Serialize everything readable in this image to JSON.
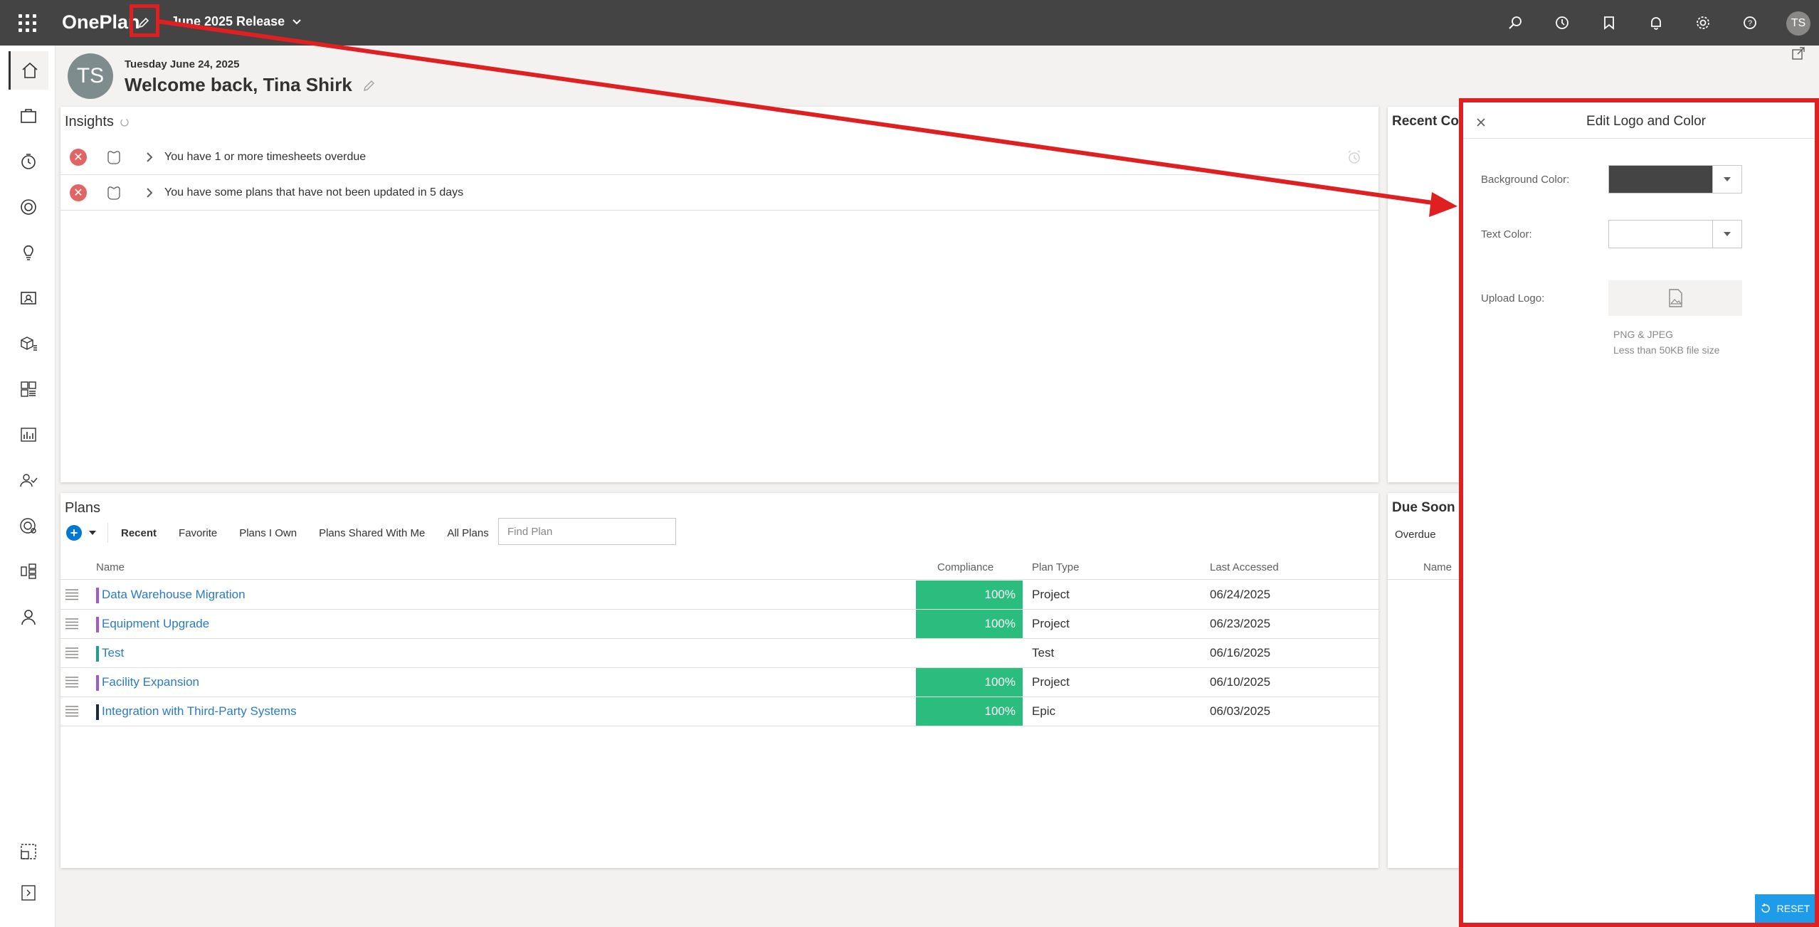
{
  "topbar": {
    "app_name": "OnePlan",
    "release_label": "June 2025 Release",
    "avatar_initials": "TS",
    "bg_color": "#444444"
  },
  "header": {
    "date": "Tuesday June 24, 2025",
    "welcome": "Welcome back, Tina Shirk",
    "avatar_initials": "TS"
  },
  "insights": {
    "title": "Insights",
    "items": [
      {
        "text": "You have 1 or more timesheets overdue"
      },
      {
        "text": "You have some plans that have not been updated in 5 days"
      }
    ]
  },
  "recent_comments": {
    "title": "Recent Co"
  },
  "plans": {
    "title": "Plans",
    "tabs": [
      "Recent",
      "Favorite",
      "Plans I Own",
      "Plans Shared With Me",
      "All Plans"
    ],
    "search_placeholder": "Find Plan",
    "columns": {
      "name": "Name",
      "compliance": "Compliance",
      "plan_type": "Plan Type",
      "last_accessed": "Last Accessed"
    },
    "rows": [
      {
        "name": "Data Warehouse Migration",
        "compliance": "100%",
        "type": "Project",
        "last": "06/24/2025",
        "color": "#a259c9"
      },
      {
        "name": "Equipment Upgrade",
        "compliance": "100%",
        "type": "Project",
        "last": "06/23/2025",
        "color": "#a259c9"
      },
      {
        "name": "Test",
        "compliance": "",
        "type": "Test",
        "last": "06/16/2025",
        "color": "#1aa38c"
      },
      {
        "name": "Facility Expansion",
        "compliance": "100%",
        "type": "Project",
        "last": "06/10/2025",
        "color": "#a259c9"
      },
      {
        "name": "Integration with Third-Party Systems",
        "compliance": "100%",
        "type": "Epic",
        "last": "06/03/2025",
        "color": "#1b2a3b"
      }
    ]
  },
  "due_soon": {
    "title": "Due Soon",
    "filter": "Overdue",
    "col_name": "Name"
  },
  "edit_panel": {
    "title": "Edit Logo and Color",
    "bg_color_label": "Background Color:",
    "text_color_label": "Text Color:",
    "upload_label": "Upload Logo:",
    "hint_line1": "PNG & JPEG",
    "hint_line2": "Less than 50KB file size",
    "reset_label": "RESET",
    "bg_color_value": "#444444",
    "text_color_value": "#ffffff"
  },
  "colors": {
    "accent": "#0078d4",
    "compliance_good": "#2bbd7e",
    "annotation": "#e02020"
  }
}
